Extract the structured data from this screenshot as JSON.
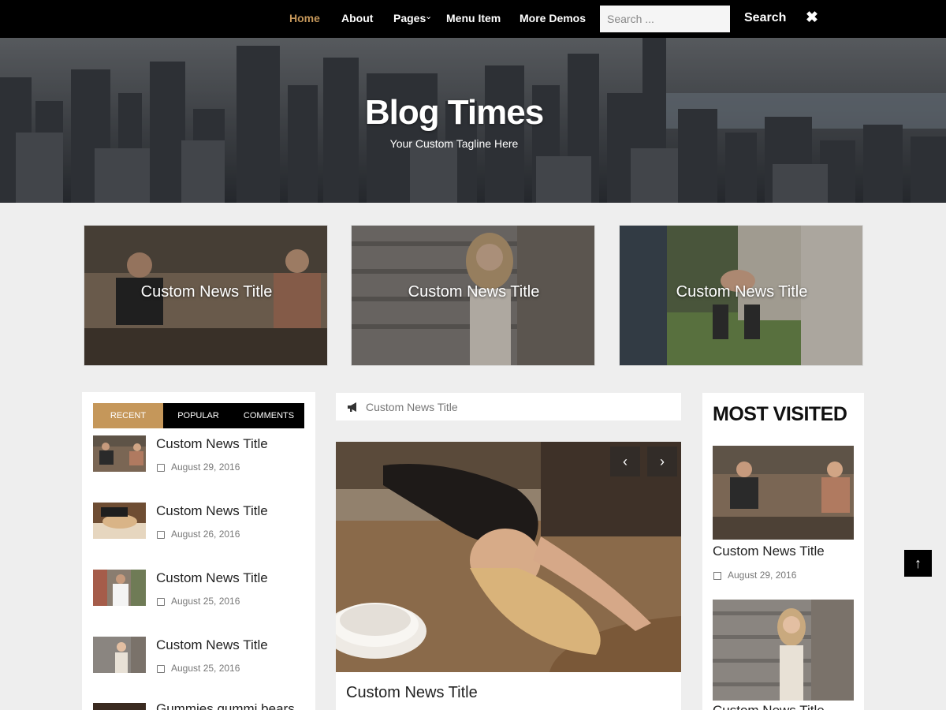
{
  "nav": {
    "items": [
      {
        "label": "Home",
        "active": true
      },
      {
        "label": "About"
      },
      {
        "label": "Pages",
        "has_dropdown": true
      },
      {
        "label": "Menu Item"
      },
      {
        "label": "More Demos"
      }
    ],
    "search_placeholder": "Search ...",
    "search_button": "Search",
    "close_glyph": "✖"
  },
  "hero": {
    "title": "Blog Times",
    "tagline": "Your Custom Tagline Here"
  },
  "featured": [
    {
      "title": "Custom News Title",
      "image": "couple-sitting-photo"
    },
    {
      "title": "Custom News Title",
      "image": "woman-on-steps-photo"
    },
    {
      "title": "Custom News Title",
      "image": "holding-hands-photo"
    }
  ],
  "sidebar_left": {
    "tabs": [
      "RECENT",
      "POPULAR",
      "COMMENTS"
    ],
    "active_tab": 0,
    "posts": [
      {
        "title": "Custom News Title",
        "date": "August 29, 2016"
      },
      {
        "title": "Custom News Title",
        "date": "August 26, 2016"
      },
      {
        "title": "Custom News Title",
        "date": "August 25, 2016"
      },
      {
        "title": "Custom News Title",
        "date": "August 25, 2016"
      },
      {
        "title": "Gummies gummi bears"
      }
    ]
  },
  "main": {
    "ticker_text": "Custom News Title",
    "slider_title": "Custom News Title",
    "prev_glyph": "‹",
    "next_glyph": "›"
  },
  "sidebar_right": {
    "heading": "MOST VISITED",
    "posts": [
      {
        "title": "Custom News Title",
        "date": "August 29, 2016"
      },
      {
        "title": "Custom News Title"
      }
    ]
  },
  "back_to_top_glyph": "↑",
  "colors": {
    "accent": "#c5975a",
    "nav_bg": "#000000",
    "page_bg": "#eeeeee"
  }
}
